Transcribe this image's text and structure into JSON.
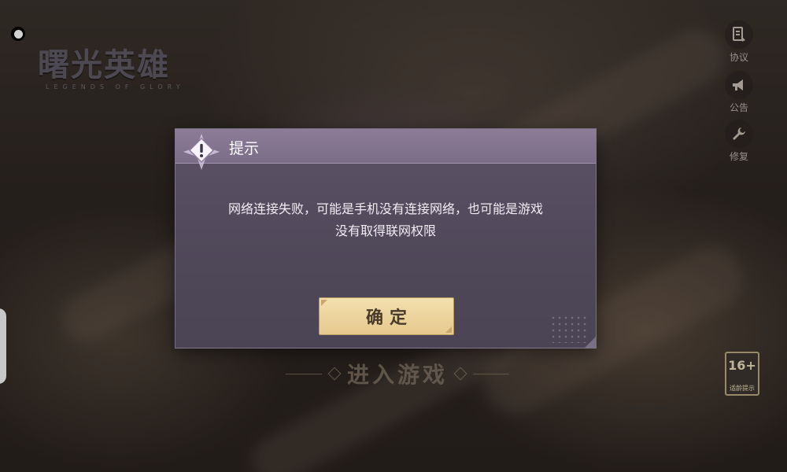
{
  "logo": {
    "title": "曙光英雄",
    "subtitle": "LEGENDS OF GLORY"
  },
  "side_menu": [
    {
      "label": "协议",
      "icon": "agreement-icon"
    },
    {
      "label": "公告",
      "icon": "megaphone-icon"
    },
    {
      "label": "修复",
      "icon": "wrench-icon"
    }
  ],
  "age_badge": {
    "rating": "16+",
    "label": "适龄提示"
  },
  "enter_game": "进入游戏",
  "dialog": {
    "title": "提示",
    "message": "网络连接失败，可能是手机没有连接网络，也可能是游戏没有取得联网权限",
    "confirm_label": "确定",
    "icon": "warning-icon"
  },
  "colors": {
    "accent": "#e6c98e",
    "dialog_header": "#7b6c88",
    "dialog_body": "#4f4859"
  }
}
